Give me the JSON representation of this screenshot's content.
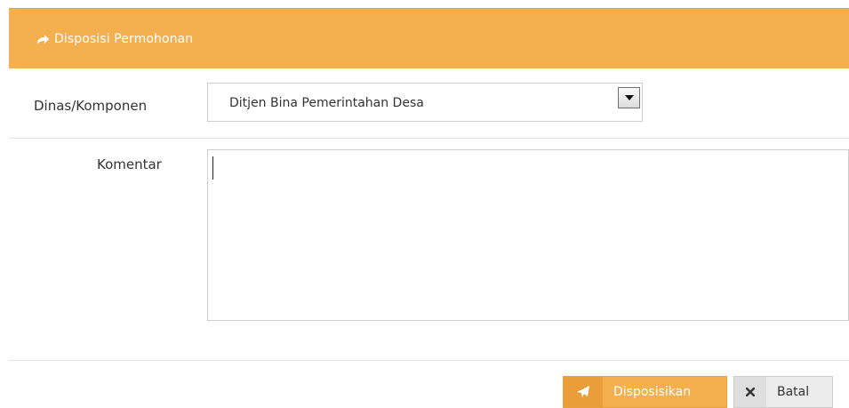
{
  "header": {
    "icon": "share-icon",
    "title": "Disposisi Permohonan"
  },
  "form": {
    "dinas_label": "Dinas/Komponen",
    "dinas_value": "Ditjen Bina Pemerintahan Desa",
    "komentar_label": "Komentar",
    "komentar_value": ""
  },
  "buttons": {
    "submit_label": "Disposisikan",
    "submit_icon": "paper-plane-icon",
    "cancel_label": "Batal",
    "cancel_icon": "times-icon"
  },
  "colors": {
    "accent": "#f4b04f",
    "accent_dark": "#ea9e3a"
  }
}
